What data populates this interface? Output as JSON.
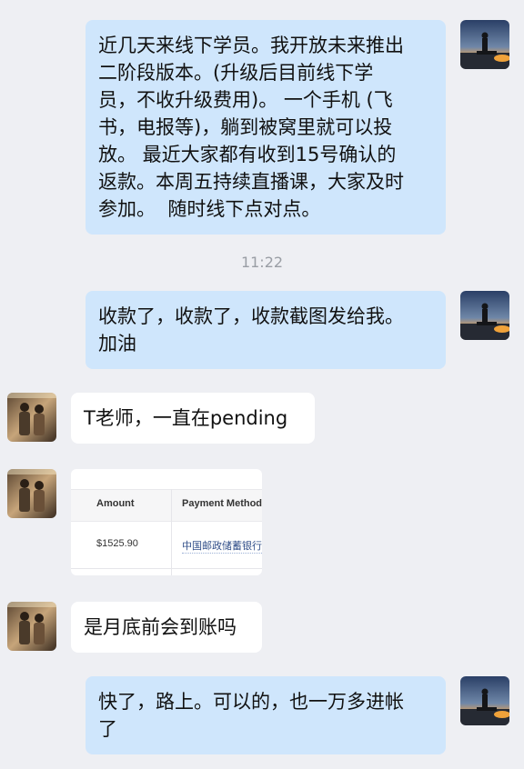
{
  "messages": {
    "m1": {
      "lines": [
        "近几天来线下学员。我开放未来推出",
        "二阶段版本。(升级后目前线下学",
        "员，不收升级费用)。 一个手机 (飞",
        "书，电报等)，躺到被窝里就可以投",
        "放。 最近大家都有收到15号确认的",
        "返款。本周五持续直播课，大家及时",
        "参加。  随时线下点对点。"
      ]
    },
    "timestamp": "11:22",
    "m2": {
      "lines": [
        "收款了，收款了，收款截图发给我。",
        "加油"
      ]
    },
    "m3": {
      "text": "T老师，一直在pending"
    },
    "m4": {
      "headers": [
        "Amount",
        "Payment Method"
      ],
      "amount": "$1525.90",
      "method": "中国邮政储蓄银行"
    },
    "m5": {
      "text": "是月底前会到账吗"
    },
    "m6": {
      "lines": [
        "快了，路上。可以的，也一万多进帐",
        "了"
      ]
    }
  },
  "colors": {
    "background": "#eeeff3",
    "outgoing_bubble": "#cfe6fc",
    "incoming_bubble": "#ffffff",
    "timestamp": "#9a9ea5"
  },
  "icons": {
    "self_avatar": "sunset-person-avatar",
    "other_avatar": "two-people-avatar"
  }
}
